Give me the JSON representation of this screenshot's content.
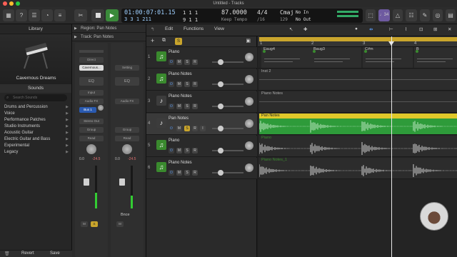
{
  "window": {
    "title": "Untitled - Tracks"
  },
  "control_bar": {
    "position": "01:00:07:01.15",
    "position_bars": "3 3 1 211",
    "beats_top": "1 1 1",
    "beats_bottom": "9 1 1",
    "tempo": "87.0000",
    "tempo_mode": "Keep Tempo",
    "time_sig": "4/4",
    "division": "/16",
    "key": "Cmaj",
    "key_value": "129",
    "in_label": "No In",
    "out_label": "No Out",
    "badge": "♩34"
  },
  "library": {
    "title": "Library",
    "patch_name": "Cavernous Dreams",
    "sounds_label": "Sounds",
    "search_placeholder": "Search Sounds",
    "categories": [
      "Drums and Percussion",
      "Voice",
      "Performance Patches",
      "Studio Instruments",
      "Acoustic Guitar",
      "Electric Guitar and Bass",
      "Experimental",
      "Legacy"
    ],
    "footer": {
      "revert": "Revert",
      "save": "Save"
    }
  },
  "inspector": {
    "region_row": "Region: Pan Notes",
    "track_row": "Track: Pan Notes",
    "strip1": {
      "setting": "Cavernous...",
      "eq": "EQ",
      "input": "Input",
      "audio_fx": "Audio FX",
      "send": "Bus 1",
      "output": "Stereo Out",
      "group": "Group",
      "automation": "Read",
      "val_left": "0.0",
      "val_right": "-24.5",
      "m": "M",
      "s": "S"
    },
    "strip2": {
      "setting": "Setting",
      "eq": "EQ",
      "audio_fx": "Audio FX",
      "group": "Group",
      "automation": "Read",
      "val_left": "0.0",
      "val_right": "-24.5",
      "name": "Bnce",
      "m": "M"
    }
  },
  "toolbar": {
    "edit": "Edit",
    "functions": "Functions",
    "view": "View"
  },
  "tracks": [
    {
      "num": "1",
      "name": "Piano",
      "type": "software",
      "color": "#3a8a2e"
    },
    {
      "num": "2",
      "name": "Piano Notes",
      "type": "software",
      "color": "#3a8a2e"
    },
    {
      "num": "3",
      "name": "Piano Notes",
      "type": "audio",
      "color": "#555555"
    },
    {
      "num": "4",
      "name": "Pan Notes",
      "type": "audio",
      "color": "#555555",
      "selected": true
    },
    {
      "num": "5",
      "name": "Piano",
      "type": "software",
      "color": "#3a8a2e"
    },
    {
      "num": "6",
      "name": "Piano Notes",
      "type": "software",
      "color": "#3a8a2e"
    }
  ],
  "ruler": {
    "bars": [
      "1",
      "2",
      "3",
      "4"
    ]
  },
  "regions": [
    {
      "lane": 0,
      "labels": [
        "Eaug4",
        "Baug3",
        "C#m",
        "B"
      ]
    },
    {
      "lane": 1,
      "labels": [
        "Inst 2"
      ]
    },
    {
      "lane": 2,
      "labels": [
        "Piano Notes"
      ]
    },
    {
      "lane": 3,
      "labels": [
        "Pan Notes"
      ]
    },
    {
      "lane": 4,
      "labels": [
        "Piano"
      ]
    },
    {
      "lane": 5,
      "labels": [
        "Piano Notes_1"
      ]
    }
  ]
}
